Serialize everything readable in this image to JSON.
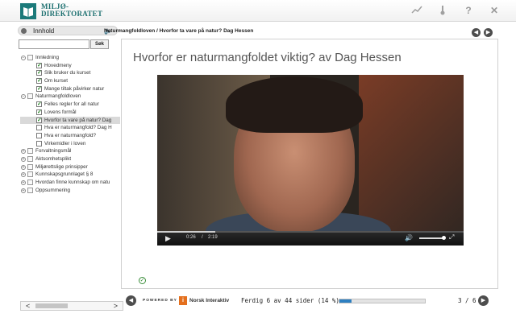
{
  "header": {
    "logo_line1": "MILJØ-",
    "logo_line2": "DIREKTORATET",
    "icons": [
      "chart-icon",
      "thermometer-icon",
      "help-icon",
      "close-icon"
    ],
    "help_label": "?",
    "close_label": "✕"
  },
  "sidebar": {
    "header_label": "Innhold",
    "search_placeholder": "",
    "search_button": "Søk",
    "tree": [
      {
        "label": "Innledning",
        "type": "group",
        "expanded": true
      },
      {
        "label": "Hovedmeny",
        "type": "item",
        "done": true
      },
      {
        "label": "Slik bruker du kurset",
        "type": "item",
        "done": true
      },
      {
        "label": "Om kurset",
        "type": "item",
        "done": true
      },
      {
        "label": "Mange tiltak påvirker natur",
        "type": "item",
        "done": true
      },
      {
        "label": "Naturmangfoldloven",
        "type": "group",
        "expanded": true
      },
      {
        "label": "Felles regler for all natur",
        "type": "item",
        "done": true
      },
      {
        "label": "Lovens formål",
        "type": "item",
        "done": true
      },
      {
        "label": "Hvorfor ta vare på natur? Dag",
        "type": "item",
        "done": true,
        "selected": true
      },
      {
        "label": "Hva er naturmangfold? Dag H",
        "type": "item",
        "done": false
      },
      {
        "label": "Hva er naturmangfold?",
        "type": "item",
        "done": false
      },
      {
        "label": "Virkemidler i loven",
        "type": "item",
        "done": false
      },
      {
        "label": "Forvaltningsmål",
        "type": "group",
        "expanded": false
      },
      {
        "label": "Aktsomhetsplikt",
        "type": "group",
        "expanded": false
      },
      {
        "label": "Miljørettslige prinsipper",
        "type": "group",
        "expanded": false
      },
      {
        "label": "Kunnskapsgrunnlaget § 8",
        "type": "group",
        "expanded": false
      },
      {
        "label": "Hvordan finne kunnskap om natu",
        "type": "group",
        "expanded": false
      },
      {
        "label": "Oppsummering",
        "type": "group",
        "expanded": false
      }
    ]
  },
  "main": {
    "breadcrumb": "Naturmangfoldloven / Hvorfor ta vare på natur? Dag Hessen",
    "title": "Hvorfor er naturmangfoldet viktig? av Dag Hessen",
    "video": {
      "current_time": "0:26",
      "separator": "/",
      "duration": "2:19",
      "progress": 0.19
    }
  },
  "footer": {
    "powered_by": "POWERED BY",
    "brand": "Norsk Interaktiv",
    "status": "Ferdig 6 av 44 sider (14 %)",
    "progress": 0.14,
    "page": "3 / 6"
  },
  "colors": {
    "accent": "#1b7a7a",
    "progress": "#2d7fc1",
    "check": "#2e8b2e"
  }
}
